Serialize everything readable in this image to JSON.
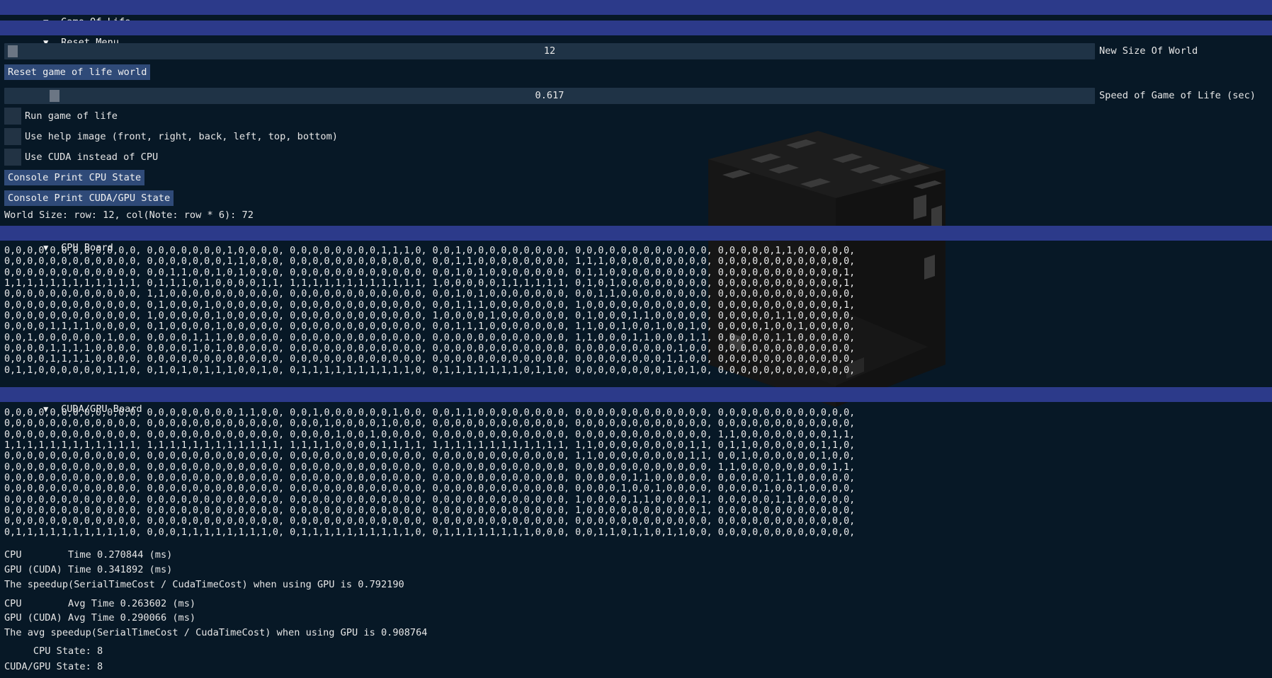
{
  "window": {
    "title": "Game Of Life"
  },
  "reset_menu": {
    "title": "Reset Menu",
    "world_size_slider": {
      "value": "12",
      "fraction": 0.0,
      "label": "New Size Of World"
    },
    "reset_button": "Reset game of life world",
    "speed_slider": {
      "value": "0.617",
      "fraction": 0.044,
      "label": "Speed of Game of Life (sec)"
    },
    "checkboxes": [
      {
        "label": "Run game of life",
        "checked": false
      },
      {
        "label": "Use help image (front, right, back, left, top, bottom)",
        "checked": false
      },
      {
        "label": "Use CUDA instead of CPU",
        "checked": false
      }
    ],
    "console_cpu_button": "Console Print CPU State",
    "console_gpu_button": "Console Print CUDA/GPU State",
    "world_size_text": "World Size: row: 12, col(Note: row * 6): 72"
  },
  "cpu_board": {
    "title": "CPU Board",
    "rows": [
      "0,0,0,0,0,0,0,0,0,0,0,0, 0,0,0,0,0,0,0,1,0,0,0,0, 0,0,0,0,0,0,0,0,1,1,1,0, 0,0,1,0,0,0,0,0,0,0,0,0, 0,0,0,0,0,0,0,0,0,0,0,0, 0,0,0,0,0,1,1,0,0,0,0,0,",
      "0,0,0,0,0,0,0,0,0,0,0,0, 0,0,0,0,0,0,0,1,1,0,0,0, 0,0,0,0,0,0,0,0,0,0,0,0, 0,0,1,1,0,0,0,0,0,0,0,0, 1,1,1,0,0,0,0,0,0,0,0,0, 0,0,0,0,0,0,0,0,0,0,0,0,",
      "0,0,0,0,0,0,0,0,0,0,0,0, 0,0,1,1,0,0,1,0,1,0,0,0, 0,0,0,0,0,0,0,0,0,0,0,0, 0,0,1,0,1,0,0,0,0,0,0,0, 0,1,1,0,0,0,0,0,0,0,0,0, 0,0,0,0,0,0,0,0,0,0,0,1,",
      "1,1,1,1,1,1,1,1,1,1,1,1, 0,1,1,1,0,1,0,0,0,0,1,1, 1,1,1,1,1,1,1,1,1,1,1,1, 1,0,0,0,0,0,1,1,1,1,1,1, 0,1,0,1,0,0,0,0,0,0,0,0, 0,0,0,0,0,0,0,0,0,0,0,1,",
      "0,0,0,0,0,0,0,0,0,0,0,0, 1,1,0,0,0,0,0,0,0,0,0,0, 0,0,0,0,0,0,0,0,0,0,0,0, 0,0,1,0,1,0,0,0,0,0,0,0, 0,0,1,1,0,0,0,0,0,0,0,0, 0,0,0,0,0,0,0,0,0,0,0,0,",
      "0,0,0,0,0,0,0,0,0,0,0,0, 0,1,0,0,0,1,0,0,0,0,0,0, 0,0,0,0,0,0,0,0,0,0,0,0, 0,0,1,1,1,0,0,0,0,0,0,0, 1,0,0,0,0,0,0,0,0,0,0,0, 0,0,0,0,0,0,0,0,0,0,0,1,",
      "0,0,0,0,0,0,0,0,0,0,0,0, 1,0,0,0,0,0,1,0,0,0,0,0, 0,0,0,0,0,0,0,0,0,0,0,0, 1,0,0,0,0,1,0,0,0,0,0,0, 0,1,0,0,0,1,1,0,0,0,0,0, 0,0,0,0,0,1,1,0,0,0,0,0,",
      "0,0,0,0,1,1,1,1,0,0,0,0, 0,1,0,0,0,0,1,0,0,0,0,0, 0,0,0,0,0,0,0,0,0,0,0,0, 0,0,1,1,1,0,0,0,0,0,0,0, 1,1,0,0,1,0,0,1,0,0,1,0, 0,0,0,0,1,0,0,1,0,0,0,0,",
      "0,0,1,0,0,0,0,0,0,1,0,0, 0,0,0,0,1,1,1,0,0,0,0,0, 0,0,0,0,0,0,0,0,0,0,0,0, 0,0,0,0,0,0,0,0,0,0,0,0, 1,1,0,0,0,1,1,0,0,0,1,1, 0,0,0,0,0,1,1,0,0,0,0,0,",
      "0,0,0,0,1,1,1,1,0,0,0,0, 0,0,0,0,1,0,1,0,0,0,0,0, 0,0,0,0,0,0,0,0,0,0,0,0, 0,0,0,0,0,0,0,0,0,0,0,0, 0,0,0,0,0,0,0,0,0,1,0,0, 0,0,0,0,0,0,0,0,0,0,0,0,",
      "0,0,0,0,1,1,1,1,0,0,0,0, 0,0,0,0,0,0,0,0,0,0,0,0, 0,0,0,0,0,0,0,0,0,0,0,0, 0,0,0,0,0,0,0,0,0,0,0,0, 0,0,0,0,0,0,0,0,1,1,0,0, 0,0,0,0,0,0,0,0,0,0,0,0,",
      "0,1,1,0,0,0,0,0,0,1,1,0, 0,1,0,1,0,1,1,1,0,0,1,0, 0,1,1,1,1,1,1,1,1,1,1,0, 0,1,1,1,1,1,1,1,0,1,1,0, 0,0,0,0,0,0,0,0,1,0,1,0, 0,0,0,0,0,0,0,0,0,0,0,0,"
    ]
  },
  "gpu_board": {
    "title": "CUDA/GPU Board",
    "rows": [
      "0,0,0,0,0,0,0,0,0,0,0,0, 0,0,0,0,0,0,0,0,1,1,0,0, 0,0,1,0,0,0,0,0,0,1,0,0, 0,0,1,1,0,0,0,0,0,0,0,0, 0,0,0,0,0,0,0,0,0,0,0,0, 0,0,0,0,0,0,0,0,0,0,0,0,",
      "0,0,0,0,0,0,0,0,0,0,0,0, 0,0,0,0,0,0,0,0,0,0,0,0, 0,0,0,1,0,0,0,0,1,0,0,0, 0,0,0,0,0,0,0,0,0,0,0,0, 0,0,0,0,0,0,0,0,0,0,0,0, 0,0,0,0,0,0,0,0,0,0,0,0,",
      "0,0,0,0,0,0,0,0,0,0,0,0, 0,0,0,0,0,0,0,0,0,0,0,0, 0,0,0,0,1,0,0,1,0,0,0,0, 0,0,0,0,0,0,0,0,0,0,0,0, 0,0,0,0,0,0,0,0,0,0,0,0, 1,1,0,0,0,0,0,0,0,0,1,1,",
      "1,1,1,1,1,1,1,1,1,1,1,1, 1,1,1,1,1,1,1,1,1,1,1,1, 1,1,1,1,0,0,0,0,1,1,1,1, 1,1,1,1,1,1,1,1,1,1,1,1, 1,1,0,0,0,0,0,0,0,0,1,1, 0,1,1,0,0,0,0,0,0,1,1,0,",
      "0,0,0,0,0,0,0,0,0,0,0,0, 0,0,0,0,0,0,0,0,0,0,0,0, 0,0,0,0,0,0,0,0,0,0,0,0, 0,0,0,0,0,0,0,0,0,0,0,0, 1,1,0,0,0,0,0,0,0,0,1,1, 0,0,1,0,0,0,0,0,0,1,0,0,",
      "0,0,0,0,0,0,0,0,0,0,0,0, 0,0,0,0,0,0,0,0,0,0,0,0, 0,0,0,0,0,0,0,0,0,0,0,0, 0,0,0,0,0,0,0,0,0,0,0,0, 0,0,0,0,0,0,0,0,0,0,0,0, 1,1,0,0,0,0,0,0,0,0,1,1,",
      "0,0,0,0,0,0,0,0,0,0,0,0, 0,0,0,0,0,0,0,0,0,0,0,0, 0,0,0,0,0,0,0,0,0,0,0,0, 0,0,0,0,0,0,0,0,0,0,0,0, 0,0,0,0,0,1,1,0,0,0,0,0, 0,0,0,0,0,1,1,0,0,0,0,0,",
      "0,0,0,0,0,0,0,0,0,0,0,0, 0,0,0,0,0,0,0,0,0,0,0,0, 0,0,0,0,0,0,0,0,0,0,0,0, 0,0,0,0,0,0,0,0,0,0,0,0, 0,0,0,0,1,0,0,1,0,0,0,0, 0,0,0,0,1,0,0,1,0,0,0,0,",
      "0,0,0,0,0,0,0,0,0,0,0,0, 0,0,0,0,0,0,0,0,0,0,0,0, 0,0,0,0,0,0,0,0,0,0,0,0, 0,0,0,0,0,0,0,0,0,0,0,0, 1,0,0,0,0,1,1,0,0,0,0,1, 0,0,0,0,0,1,1,0,0,0,0,0,",
      "0,0,0,0,0,0,0,0,0,0,0,0, 0,0,0,0,0,0,0,0,0,0,0,0, 0,0,0,0,0,0,0,0,0,0,0,0, 0,0,0,0,0,0,0,0,0,0,0,0, 1,0,0,0,0,0,0,0,0,0,0,1, 0,0,0,0,0,0,0,0,0,0,0,0,",
      "0,0,0,0,0,0,0,0,0,0,0,0, 0,0,0,0,0,0,0,0,0,0,0,0, 0,0,0,0,0,0,0,0,0,0,0,0, 0,0,0,0,0,0,0,0,0,0,0,0, 0,0,0,0,0,0,0,0,0,0,0,0, 0,0,0,0,0,0,0,0,0,0,0,0,",
      "0,1,1,1,1,1,1,1,1,1,1,0, 0,0,0,1,1,1,1,1,1,1,1,0, 0,1,1,1,1,1,1,1,1,1,1,0, 0,1,1,1,1,1,1,1,1,0,0,0, 0,0,1,1,0,1,1,0,1,1,0,0, 0,0,0,0,0,0,0,0,0,0,0,0,"
    ]
  },
  "stats": {
    "cpu_time": "CPU        Time 0.270844 (ms)",
    "gpu_time": "GPU (CUDA) Time 0.341892 (ms)",
    "speedup": "The speedup(SerialTimeCost / CudaTimeCost) when using GPU is 0.792190",
    "cpu_avg": "CPU        Avg Time 0.263602 (ms)",
    "gpu_avg": "GPU (CUDA) Avg Time 0.290066 (ms)",
    "avg_speedup": "The avg speedup(SerialTimeCost / CudaTimeCost) when using GPU is 0.908764",
    "cpu_state": "     CPU State: 8",
    "gpu_state": "CUDA/GPU State: 8"
  },
  "colors": {
    "background": "#071826",
    "header": "#2c3a8a",
    "button": "#2f4a78",
    "frame": "#1f3346",
    "cube_face": "#1a1a1a"
  },
  "icons": {
    "collapse": "triangle-down-icon"
  }
}
